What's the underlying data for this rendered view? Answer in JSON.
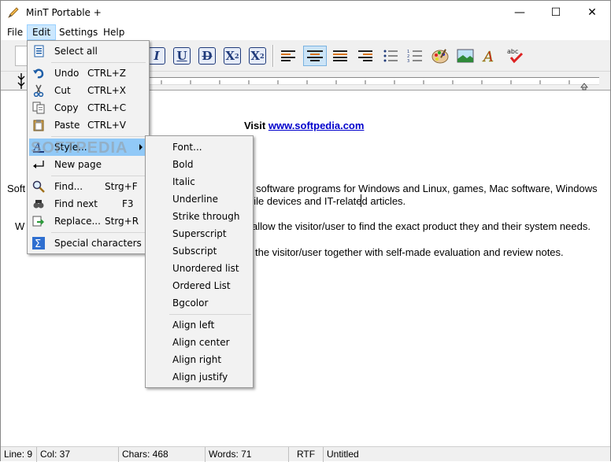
{
  "window": {
    "title": "MinT Portable +",
    "controls": {
      "minimize": "—",
      "maximize": "☐",
      "close": "✕"
    }
  },
  "menubar": [
    "File",
    "Edit",
    "Settings",
    "Help"
  ],
  "toolbar": {
    "format_buttons": [
      {
        "name": "italic-button",
        "glyph": "I",
        "icon": "italic-icon"
      },
      {
        "name": "underline-button",
        "glyph": "U",
        "icon": "underline-icon"
      },
      {
        "name": "strikethrough-button",
        "glyph": "D",
        "icon": "strikethrough-icon"
      },
      {
        "name": "superscript-button",
        "glyph": "X",
        "icon": "superscript-icon",
        "script": "2"
      },
      {
        "name": "subscript-button",
        "glyph": "X",
        "icon": "subscript-icon",
        "script": "2"
      }
    ],
    "align_buttons": [
      "align-left-icon",
      "align-center-icon",
      "align-justify-icon",
      "align-right-icon"
    ],
    "list_buttons": [
      "unordered-list-icon",
      "ordered-list-icon"
    ],
    "extra_buttons": [
      "palette-icon",
      "image-icon",
      "font-icon",
      "spellcheck-icon"
    ],
    "accent_color": "#1f3a7a",
    "pressed_color": "#cce4f7"
  },
  "document": {
    "line1_prefix": "Visit ",
    "line1_link": "www.softpedia.com",
    "line2_left": "Soft",
    "line2_right": "y software programs for Windows and Linux, games, Mac software, Windows",
    "line3_right": "bile devices and IT-related articles.",
    "line4_left": "W",
    "line4_right": "allow the visitor/user to find the exact product they and their system needs.",
    "line5_right": "the visitor/user together with self-made evaluation and review notes.",
    "link_color": "#0000cc"
  },
  "watermark": "SOFTPEDIA",
  "edit_menu": {
    "items": [
      {
        "label": "Select all",
        "shortcut": "",
        "icon": "select-all-icon"
      },
      {
        "label": "Undo",
        "shortcut": "CTRL+Z",
        "icon": "undo-icon"
      },
      {
        "label": "Cut",
        "shortcut": "CTRL+X",
        "icon": "cut-icon"
      },
      {
        "label": "Copy",
        "shortcut": "CTRL+C",
        "icon": "copy-icon"
      },
      {
        "label": "Paste",
        "shortcut": "CTRL+V",
        "icon": "paste-icon"
      },
      {
        "label": "Style...",
        "shortcut": "",
        "icon": "style-icon",
        "submenu": true
      },
      {
        "label": "New page",
        "shortcut": "",
        "icon": "new-page-icon"
      },
      {
        "label": "Find...",
        "shortcut": "Strg+F",
        "icon": "find-icon"
      },
      {
        "label": "Find next",
        "shortcut": "F3",
        "icon": "find-next-icon"
      },
      {
        "label": "Replace...",
        "shortcut": "Strg+R",
        "icon": "replace-icon"
      },
      {
        "label": "Special characters",
        "shortcut": "",
        "icon": "special-characters-icon"
      }
    ]
  },
  "style_menu": {
    "items": [
      "Font...",
      "Bold",
      "Italic",
      "Underline",
      "Strike through",
      "Superscript",
      "Subscript",
      "Unordered list",
      "Ordered List",
      "Bgcolor",
      "Align left",
      "Align center",
      "Align right",
      "Align justify"
    ]
  },
  "statusbar": {
    "line": "Line:  9",
    "col": "Col:  37",
    "chars": "Chars: 468",
    "words": "Words: 71",
    "format": "RTF",
    "filename": "Untitled"
  }
}
